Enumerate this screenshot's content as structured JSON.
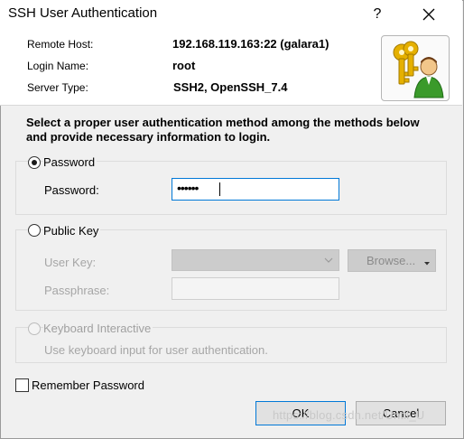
{
  "window": {
    "title": "SSH User Authentication",
    "help_label": "?"
  },
  "info": {
    "remote_host_label": "Remote Host:",
    "remote_host_value": "192.168.119.163:22 (galara1)",
    "login_name_label": "Login Name:",
    "login_name_value": "root",
    "server_type_label": "Server Type:",
    "server_type_value": "SSH2, OpenSSH_7.4"
  },
  "instructions": "Select a proper user authentication method among the methods below and provide necessary information to login.",
  "password_method": {
    "label": "Password",
    "selected": true,
    "field_label": "Password:",
    "field_value": "••••••"
  },
  "public_key_method": {
    "label": "Public Key",
    "selected": false,
    "user_key_label": "User Key:",
    "browse_label": "Browse...",
    "passphrase_label": "Passphrase:"
  },
  "keyboard_method": {
    "label": "Keyboard Interactive",
    "selected": false,
    "description": "Use keyboard input for user authentication."
  },
  "remember": {
    "label": "Remember Password",
    "checked": false
  },
  "buttons": {
    "ok": "OK",
    "cancel": "Cancel"
  },
  "watermark": "https://blog.csdn.net/Until_U",
  "icons": {
    "close": "close-icon",
    "key": "key-user-icon",
    "dropdown": "chevron-down-icon",
    "browse_menu": "dropdown-arrow-icon"
  },
  "colors": {
    "focus_border": "#0078d7",
    "window_bg": "#f0f0f0",
    "disabled_text": "#a0a0a0"
  }
}
